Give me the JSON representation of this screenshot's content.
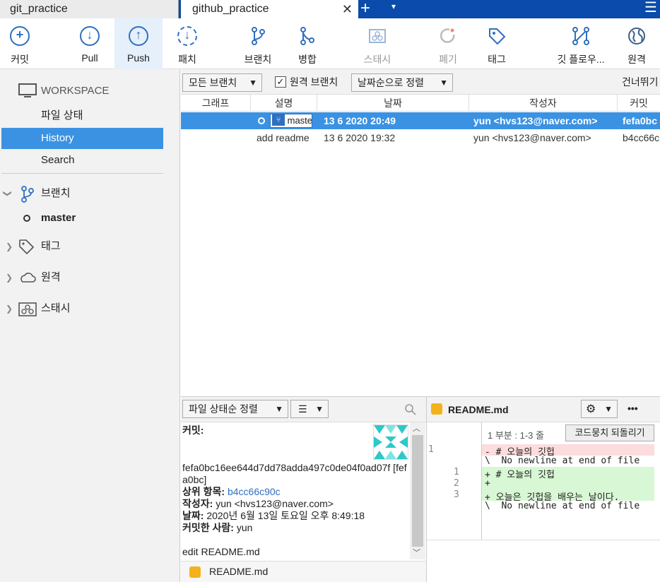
{
  "tabs": {
    "tab1": "git_practice",
    "tab2": "github_practice",
    "close": "✕",
    "plus": "+",
    "caret": "▾",
    "menu": "☰"
  },
  "toolbar": {
    "commit": "커밋",
    "pull": "Pull",
    "push": "Push",
    "fetch": "패치",
    "branch": "브랜치",
    "merge": "병합",
    "stash": "스태시",
    "discard": "폐기",
    "tag": "태그",
    "gitflow": "깃 플로우...",
    "remote": "원격"
  },
  "sidebar": {
    "workspace": "WORKSPACE",
    "file_status": "파일 상태",
    "history": "History",
    "search": "Search",
    "branches": "브랜치",
    "master": "master",
    "tags": "태그",
    "remotes": "원격",
    "stashes": "스태시"
  },
  "filterbar": {
    "all_branches": "모든 브랜치",
    "remote_branches": "원격 브랜치",
    "sort_by_date": "날짜순으로 정렬",
    "skip": "건너뛰기"
  },
  "columns": {
    "graph": "그래프",
    "desc": "설명",
    "date": "날짜",
    "author": "작성자",
    "commit": "커밋"
  },
  "commits": [
    {
      "branch": "master",
      "desc": "",
      "date": "13 6 2020 20:49",
      "author": "yun <hvs123@naver.com>",
      "hash": "fefa0bc"
    },
    {
      "branch": "",
      "desc": "add readme",
      "date": "13 6 2020 19:32",
      "author": "yun <hvs123@naver.com>",
      "hash": "b4cc66c"
    }
  ],
  "details": {
    "sort_files": "파일 상태순 정렬",
    "commit_label": "커밋:",
    "hash_full": "fefa0bc16ee644d7dd78adda497c0de04f0ad07f [fefa0bc]",
    "parent_label": "상위 항목:",
    "parent_value": "b4cc66c90c",
    "author_label": "작성자:",
    "author_value": "yun <hvs123@naver.com>",
    "date_label": "날짜:",
    "date_value": "2020년 6월 13일 토요일 오후 8:49:18",
    "committer_label": "커밋한 사람:",
    "committer_value": "yun",
    "message": "edit README.md",
    "file": "README.md"
  },
  "diff": {
    "file": "README.md",
    "hunk": "1 부분 : 1-3 줄",
    "revert": "코드뭉치 되돌리기",
    "more": "•••",
    "lines": [
      {
        "old": "1",
        "new": "",
        "type": "del",
        "text": "- # 오늘의 깃헙"
      },
      {
        "old": "",
        "new": "",
        "type": "ctx",
        "text": "\\  No newline at end of file"
      },
      {
        "old": "",
        "new": "1",
        "type": "add",
        "text": "+ # 오늘의 깃헙"
      },
      {
        "old": "",
        "new": "2",
        "type": "add",
        "text": "+"
      },
      {
        "old": "",
        "new": "3",
        "type": "add",
        "text": "+ 오늘은 깃헙을 배우는 날이다."
      },
      {
        "old": "",
        "new": "",
        "type": "ctx",
        "text": "\\  No newline at end of file"
      }
    ]
  },
  "colors": {
    "accent": "#3b92e2",
    "titlebar": "#0a4bab",
    "del": "#fcdcdc",
    "add": "#d8f7d4"
  }
}
